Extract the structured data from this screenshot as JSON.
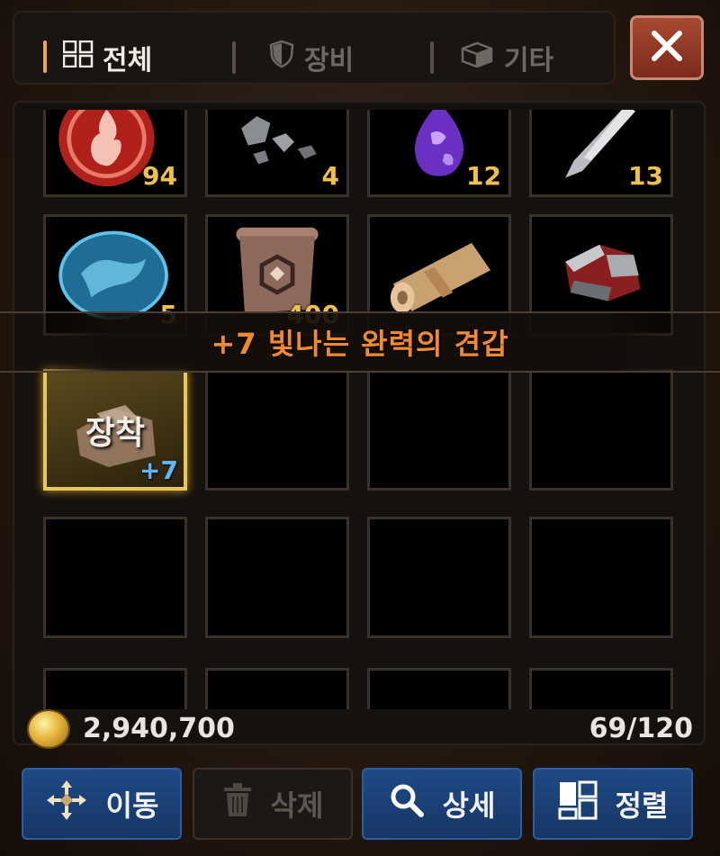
{
  "tabs": [
    {
      "label": "전체",
      "icon": "grid-icon",
      "active": true
    },
    {
      "label": "장비",
      "icon": "shield-icon",
      "active": false
    },
    {
      "label": "기타",
      "icon": "box-icon",
      "active": false
    }
  ],
  "close_icon": "close-icon",
  "items": [
    {
      "name": "fire-emblem",
      "qty": "94"
    },
    {
      "name": "ore-fragments",
      "qty": "4"
    },
    {
      "name": "purple-gem",
      "qty": "12"
    },
    {
      "name": "blade-shard",
      "qty": "13"
    },
    {
      "name": "dragon-stone",
      "qty": "5"
    },
    {
      "name": "ancient-scroll",
      "qty": "400"
    },
    {
      "name": "rolled-parchment",
      "qty": ""
    },
    {
      "name": "gauntlet-armor",
      "qty": ""
    }
  ],
  "tooltip": "+7 빛나는 완력의 견갑",
  "equipped_item": {
    "label": "장착",
    "enhance": "+7"
  },
  "footer": {
    "gold": "2,940,700",
    "capacity": "69/120"
  },
  "buttons": [
    {
      "label": "이동",
      "icon": "move-icon",
      "enabled": true
    },
    {
      "label": "삭제",
      "icon": "trash-icon",
      "enabled": false
    },
    {
      "label": "상세",
      "icon": "magnifier-icon",
      "enabled": true
    },
    {
      "label": "정렬",
      "icon": "sort-grid-icon",
      "enabled": true
    }
  ],
  "colors": {
    "accent_gold": "#e8c75a",
    "qty": "#f0c04d",
    "tooltip_text": "#f08a30",
    "enhance": "#5ab6ff",
    "button_blue": "#1f4a86"
  }
}
